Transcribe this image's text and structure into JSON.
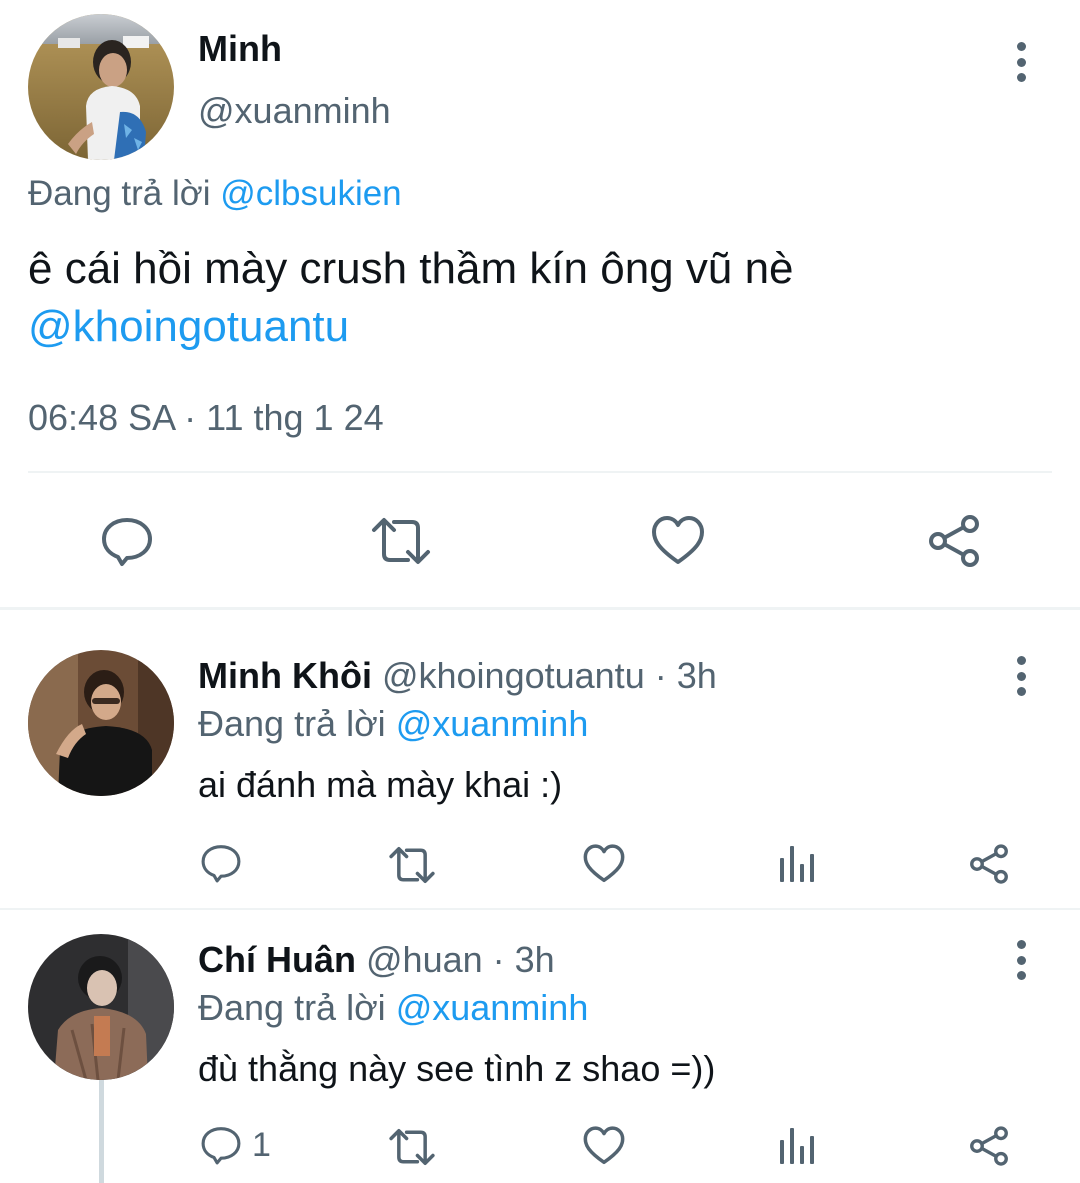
{
  "main_tweet": {
    "display_name": "Minh",
    "handle": "@xuanminh",
    "reply_prefix": "Đang trả lời",
    "reply_to": "@clbsukien",
    "text": "ê cái hồi mày crush thầm kín ông vũ nè",
    "mention": "@khoingotuantu",
    "timestamp": "06:48 SA · 11 thg 1 24",
    "actions": [
      "reply-icon",
      "retweet-icon",
      "like-icon",
      "share-icon"
    ]
  },
  "replies": [
    {
      "display_name": "Minh Khôi",
      "handle": "@khoingotuantu",
      "time": "· 3h",
      "reply_prefix": "Đang trả lời",
      "reply_to": "@xuanminh",
      "text": "ai đánh mà mày khai :)",
      "reply_count": "",
      "actions": [
        "reply-icon",
        "retweet-icon",
        "like-icon",
        "views-icon",
        "share-icon"
      ]
    },
    {
      "display_name": "Chí Huân",
      "handle": "@huan",
      "time": "· 3h",
      "reply_prefix": "Đang trả lời",
      "reply_to": "@xuanminh",
      "text": "đù thằng này see tình z shao =))",
      "reply_count": "1",
      "actions": [
        "reply-icon",
        "retweet-icon",
        "like-icon",
        "views-icon",
        "share-icon"
      ]
    }
  ],
  "colors": {
    "link": "#1d9bf0",
    "secondary_text": "#536471",
    "divider": "#eff3f4"
  }
}
